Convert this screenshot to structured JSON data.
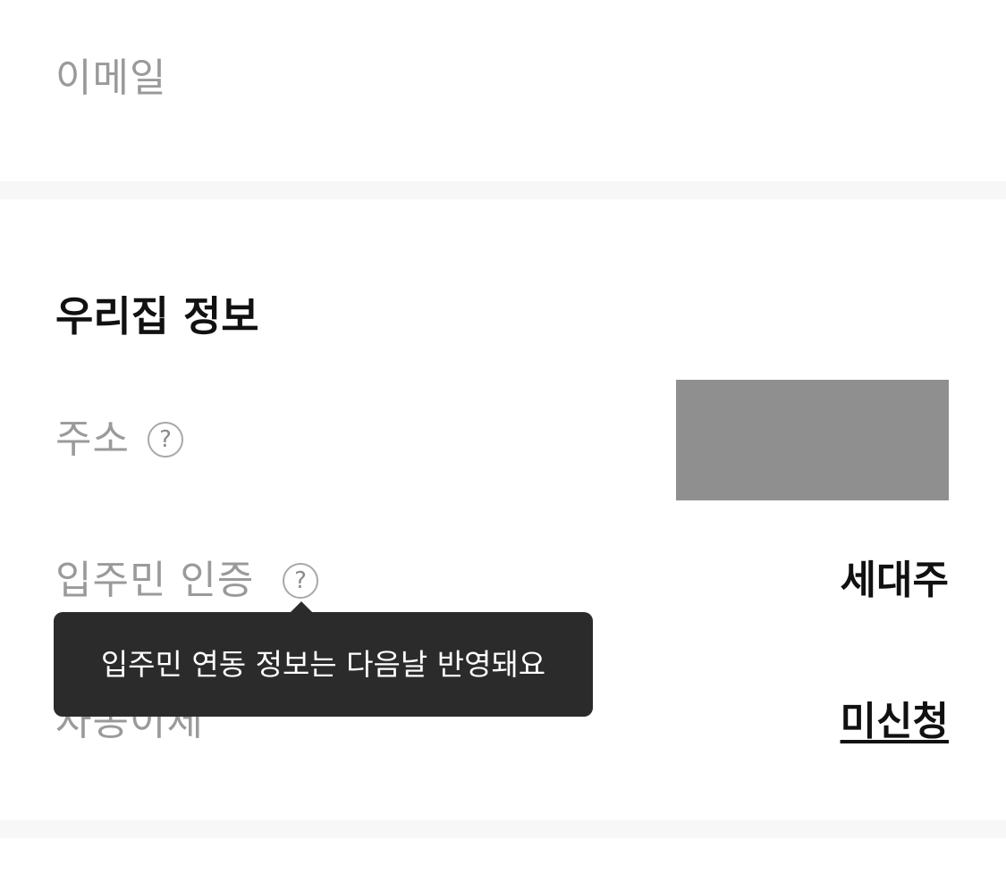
{
  "email": {
    "label": "이메일"
  },
  "home_info": {
    "title": "우리집 정보",
    "address": {
      "label": "주소",
      "help_icon": "?"
    },
    "resident_auth": {
      "label": "입주민 인증",
      "help_icon": "?",
      "value": "세대주"
    },
    "auto_transfer": {
      "label": "자동이체",
      "value": "미신청"
    },
    "tooltip": "입주민 연동 정보는 다음날 반영돼요"
  }
}
